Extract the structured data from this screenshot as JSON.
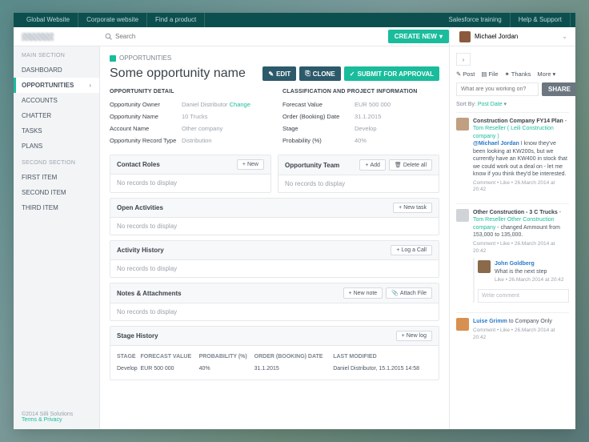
{
  "topnav": {
    "left": [
      "Global Website",
      "Corporate website",
      "Find a product"
    ],
    "right": [
      "Salesforce training",
      "Help & Support"
    ]
  },
  "search": {
    "placeholder": "Search"
  },
  "create_label": "CREATE NEW",
  "user": {
    "name": "Michael Jordan"
  },
  "sidebar": {
    "section1_head": "MAIN SECTION",
    "section1": [
      "DASHBOARD",
      "OPPORTUNITIES",
      "ACCOUNTS",
      "CHATTER",
      "TASKS",
      "PLANS"
    ],
    "section2_head": "SECOND SECTION",
    "section2": [
      "FIRST ITEM",
      "SECOND ITEM",
      "THIRD ITEM"
    ],
    "footer_copy": "©2014 Silli Solutions",
    "footer_link": "Terms & Privacy"
  },
  "breadcrumb": "OPPORTUNITIES",
  "page_title": "Some opportunity name",
  "actions": {
    "edit": "EDIT",
    "clone": "CLONE",
    "submit": "SUBMIT FOR APPROVAL"
  },
  "detail": {
    "left_head": "OPPORTUNITY DETAIL",
    "right_head": "CLASSIFICATION AND PROJECT INFORMATION",
    "left": [
      {
        "k": "Opportunity Owner",
        "v": "Daniel Distributor",
        "link": "Change"
      },
      {
        "k": "Opportunity Name",
        "v": "10 Trucks"
      },
      {
        "k": "Account Name",
        "v": "Other company"
      },
      {
        "k": "Opportunity Record Type",
        "v": "Distribution"
      }
    ],
    "right": [
      {
        "k": "Forecast Value",
        "v": "EUR 500 000"
      },
      {
        "k": "Order (Booking) Date",
        "v": "31.1.2015"
      },
      {
        "k": "Stage",
        "v": "Develop"
      },
      {
        "k": "Probability (%)",
        "v": "40%"
      }
    ]
  },
  "panels": {
    "contact_roles": {
      "title": "Contact Roles",
      "new": "New",
      "empty": "No records to display"
    },
    "opp_team": {
      "title": "Opportunity Team",
      "add": "Add",
      "delete": "Delete all",
      "empty": "No records to display"
    },
    "open_act": {
      "title": "Open Activities",
      "new": "New task",
      "empty": "No records to display"
    },
    "act_hist": {
      "title": "Activity History",
      "log": "Log a Call",
      "empty": "No records to display"
    },
    "notes": {
      "title": "Notes & Attachments",
      "new": "New note",
      "attach": "Attach File",
      "empty": "No records to display"
    },
    "stage": {
      "title": "Stage History",
      "new": "New log",
      "cols": [
        "STAGE",
        "FORECAST VALUE",
        "PROBABILITY (%)",
        "ORDER (BOOKING) DATE",
        "LAST MODIFIED"
      ],
      "row": [
        "Develop",
        "EUR 500 000",
        "40%",
        "31.1.2015",
        "Daniel Distributor, 15.1.2015 14:58"
      ]
    }
  },
  "rside": {
    "tabs": {
      "post": "Post",
      "file": "File",
      "thanks": "Thanks",
      "more": "More"
    },
    "share_placeholder": "What are you working on?",
    "share_btn": "SHARE",
    "sort_label": "Sort By:",
    "sort_value": "Post Date",
    "feed": [
      {
        "title": "Construction Company FY14 Plan",
        "by": "Tom Reseller ( Leili Construction company )",
        "mention": "@Michael Jordan",
        "body": "I know they've been looking at KW200s, but we currently have an KW400 in stock that we could work out a deal on - let me know if you think they'd be interested.",
        "meta": "Comment  •  Like  •  26.March  2014 at 20:42"
      },
      {
        "title": "Other Construction - 3 C Trucks",
        "by": "Tom Reseller",
        "by2": "Other Construction company",
        "body": "changed Ammount from 153,000 to 135,000.",
        "meta": "Comment  •  Like  •  26.March  2014 at 20:42",
        "reply": {
          "name": "John Goldberg",
          "body": "What is the next step",
          "meta": "Like  •  26.March  2014 at 20:42",
          "write": "Write comment"
        }
      },
      {
        "title_name": "Luise Grimm",
        "title_rest": "to Company Only",
        "meta": "Comment  •  Like  •  26.March  2014 at 20:42"
      }
    ]
  }
}
